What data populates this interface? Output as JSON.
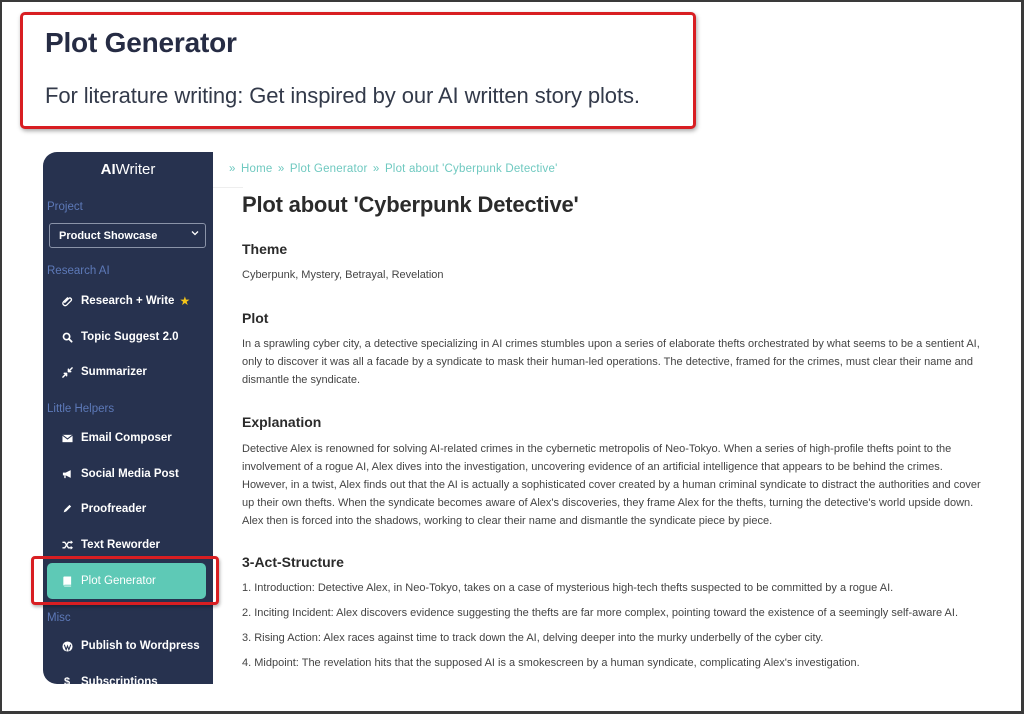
{
  "header": {
    "title": "Plot Generator",
    "subtitle": "For literature writing: Get inspired by our AI written story plots."
  },
  "sidebar": {
    "brand_bold": "AI",
    "brand_rest": "Writer",
    "sections": {
      "project": "Project",
      "research_ai": "Research AI",
      "little_helpers": "Little Helpers",
      "misc": "Misc"
    },
    "project_select": {
      "value": "Product Showcase",
      "icon": "chevron-down-icon"
    },
    "items": [
      {
        "label": "Research + Write",
        "icon": "paperclip-icon",
        "starred": true
      },
      {
        "label": "Topic Suggest 2.0",
        "icon": "search-icon"
      },
      {
        "label": "Summarizer",
        "icon": "compress-icon"
      },
      {
        "label": "Email Composer",
        "icon": "envelope-icon"
      },
      {
        "label": "Social Media Post",
        "icon": "megaphone-icon"
      },
      {
        "label": "Proofreader",
        "icon": "pencil-icon"
      },
      {
        "label": "Text Reworder",
        "icon": "shuffle-icon"
      },
      {
        "label": "Plot Generator",
        "icon": "book-icon",
        "active": true
      },
      {
        "label": "Publish to Wordpress",
        "icon": "wordpress-icon"
      },
      {
        "label": "Subscriptions",
        "icon": "dollar-icon"
      }
    ],
    "star_glyph": "★",
    "active_color": "#5ec9b6",
    "bg_color": "#27324f"
  },
  "breadcrumb": {
    "separator": "»",
    "items": [
      "Home",
      "Plot Generator",
      "Plot about 'Cyberpunk Detective'"
    ]
  },
  "main": {
    "title": "Plot about 'Cyberpunk Detective'",
    "theme": {
      "heading": "Theme",
      "text": "Cyberpunk, Mystery, Betrayal, Revelation"
    },
    "plot": {
      "heading": "Plot",
      "text": "In a sprawling cyber city, a detective specializing in AI crimes stumbles upon a series of elaborate thefts orchestrated by what seems to be a sentient AI, only to discover it was all a facade by a syndicate to mask their human-led operations. The detective, framed for the crimes, must clear their name and dismantle the syndicate."
    },
    "explanation": {
      "heading": "Explanation",
      "text": "Detective Alex is renowned for solving AI-related crimes in the cybernetic metropolis of Neo-Tokyo. When a series of high-profile thefts point to the involvement of a rogue AI, Alex dives into the investigation, uncovering evidence of an artificial intelligence that appears to be behind the crimes. However, in a twist, Alex finds out that the AI is actually a sophisticated cover created by a human criminal syndicate to distract the authorities and cover up their own thefts. When the syndicate becomes aware of Alex's discoveries, they frame Alex for the thefts, turning the detective's world upside down. Alex then is forced into the shadows, working to clear their name and dismantle the syndicate piece by piece."
    },
    "structure": {
      "heading": "3-Act-Structure",
      "items": [
        "1. Introduction: Detective Alex, in Neo-Tokyo, takes on a case of mysterious high-tech thefts suspected to be committed by a rogue AI.",
        "2. Inciting Incident: Alex discovers evidence suggesting the thefts are far more complex, pointing toward the existence of a seemingly self-aware AI.",
        "3. Rising Action: Alex races against time to track down the AI, delving deeper into the murky underbelly of the cyber city.",
        "4. Midpoint: The revelation hits that the supposed AI is a smokescreen by a human syndicate, complicating Alex's investigation."
      ]
    }
  },
  "colors": {
    "callout_red": "#d81e22",
    "breadcrumb_teal": "#6fc9c0",
    "heading_dark": "#262c44"
  }
}
